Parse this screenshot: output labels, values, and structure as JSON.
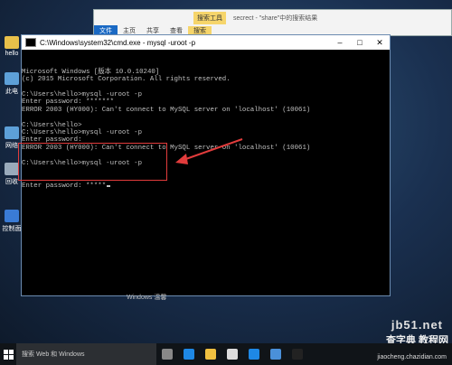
{
  "desktop": {
    "icons": [
      {
        "label": "hello",
        "color": "#e8c04a"
      },
      {
        "label": "此电",
        "color": "#5da0d8"
      },
      {
        "label": "网络",
        "color": "#5da0d8"
      },
      {
        "label": "回收",
        "color": "#9ab"
      },
      {
        "label": "控制面",
        "color": "#3a7bd5"
      }
    ]
  },
  "explorer": {
    "tab_highlight": "搜索工具",
    "title": "secrect - \"share\"中的搜索结果",
    "ribbon": [
      "文件",
      "主页",
      "共享",
      "查看",
      "搜索"
    ]
  },
  "cmd": {
    "title": "C:\\Windows\\system32\\cmd.exe - mysql -uroot -p",
    "lines": [
      "Microsoft Windows [版本 10.0.10240]",
      "(c) 2015 Microsoft Corporation. All rights reserved.",
      "",
      "C:\\Users\\hello>mysql -uroot -p",
      "Enter password: *******",
      "ERROR 2003 (HY000): Can't connect to MySQL server on 'localhost' (10061)",
      "",
      "C:\\Users\\hello>",
      "C:\\Users\\hello>mysql -uroot -p",
      "Enter password:",
      "ERROR 2003 (HY000): Can't connect to MySQL server on 'localhost' (10061)",
      "",
      "C:\\Users\\hello>mysql -uroot -p"
    ],
    "last_line": "Enter password: *****"
  },
  "footer_fragment": "Windows 温馨",
  "taskbar": {
    "search_placeholder": "搜索 Web 和 Windows",
    "icons": [
      {
        "name": "task-view-icon",
        "color": "#888"
      },
      {
        "name": "edge-icon",
        "color": "#1e88e5"
      },
      {
        "name": "explorer-icon",
        "color": "#f0c040"
      },
      {
        "name": "store-icon",
        "color": "#ddd"
      },
      {
        "name": "settings-icon",
        "color": "#1e88e5"
      },
      {
        "name": "mail-icon",
        "color": "#4a90d9"
      },
      {
        "name": "cmd-icon",
        "color": "#222"
      }
    ]
  },
  "watermark": {
    "site": "jb51.net",
    "brand": "查字典 教程网",
    "url": "jiaocheng.chazidian.com"
  }
}
